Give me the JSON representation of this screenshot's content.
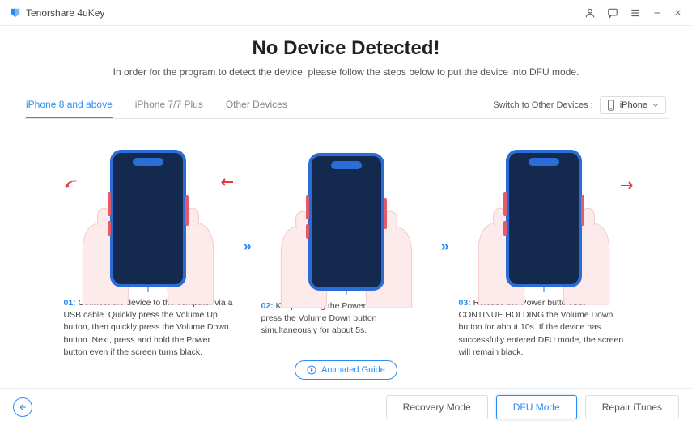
{
  "app": {
    "name": "Tenorshare 4uKey"
  },
  "header": {
    "title": "No Device Detected!",
    "subtitle": "In order for the program to detect the device, please follow the steps below to put the device into DFU mode."
  },
  "tabs": [
    {
      "label": "iPhone 8 and above",
      "active": true
    },
    {
      "label": "iPhone 7/7 Plus",
      "active": false
    },
    {
      "label": "Other Devices",
      "active": false
    }
  ],
  "switch": {
    "label": "Switch to Other Devices :",
    "selected": "iPhone"
  },
  "steps": [
    {
      "num": "01:",
      "text": "Connect the device to the computer via a USB cable. Quickly press the Volume Up button, then quickly press the Volume Down button. Next, press and hold the Power button even if the screen turns black."
    },
    {
      "num": "02:",
      "text": "Keep holding the Power button and press the Volume Down button simultaneously for about 5s."
    },
    {
      "num": "03:",
      "text": "Release the Power button but CONTINUE HOLDING the Volume Down button for about 10s. If the device has successfully entered DFU mode, the screen will remain black."
    }
  ],
  "animated_guide": "Animated Guide",
  "footer": {
    "recovery": "Recovery Mode",
    "dfu": "DFU Mode",
    "repair": "Repair iTunes"
  }
}
